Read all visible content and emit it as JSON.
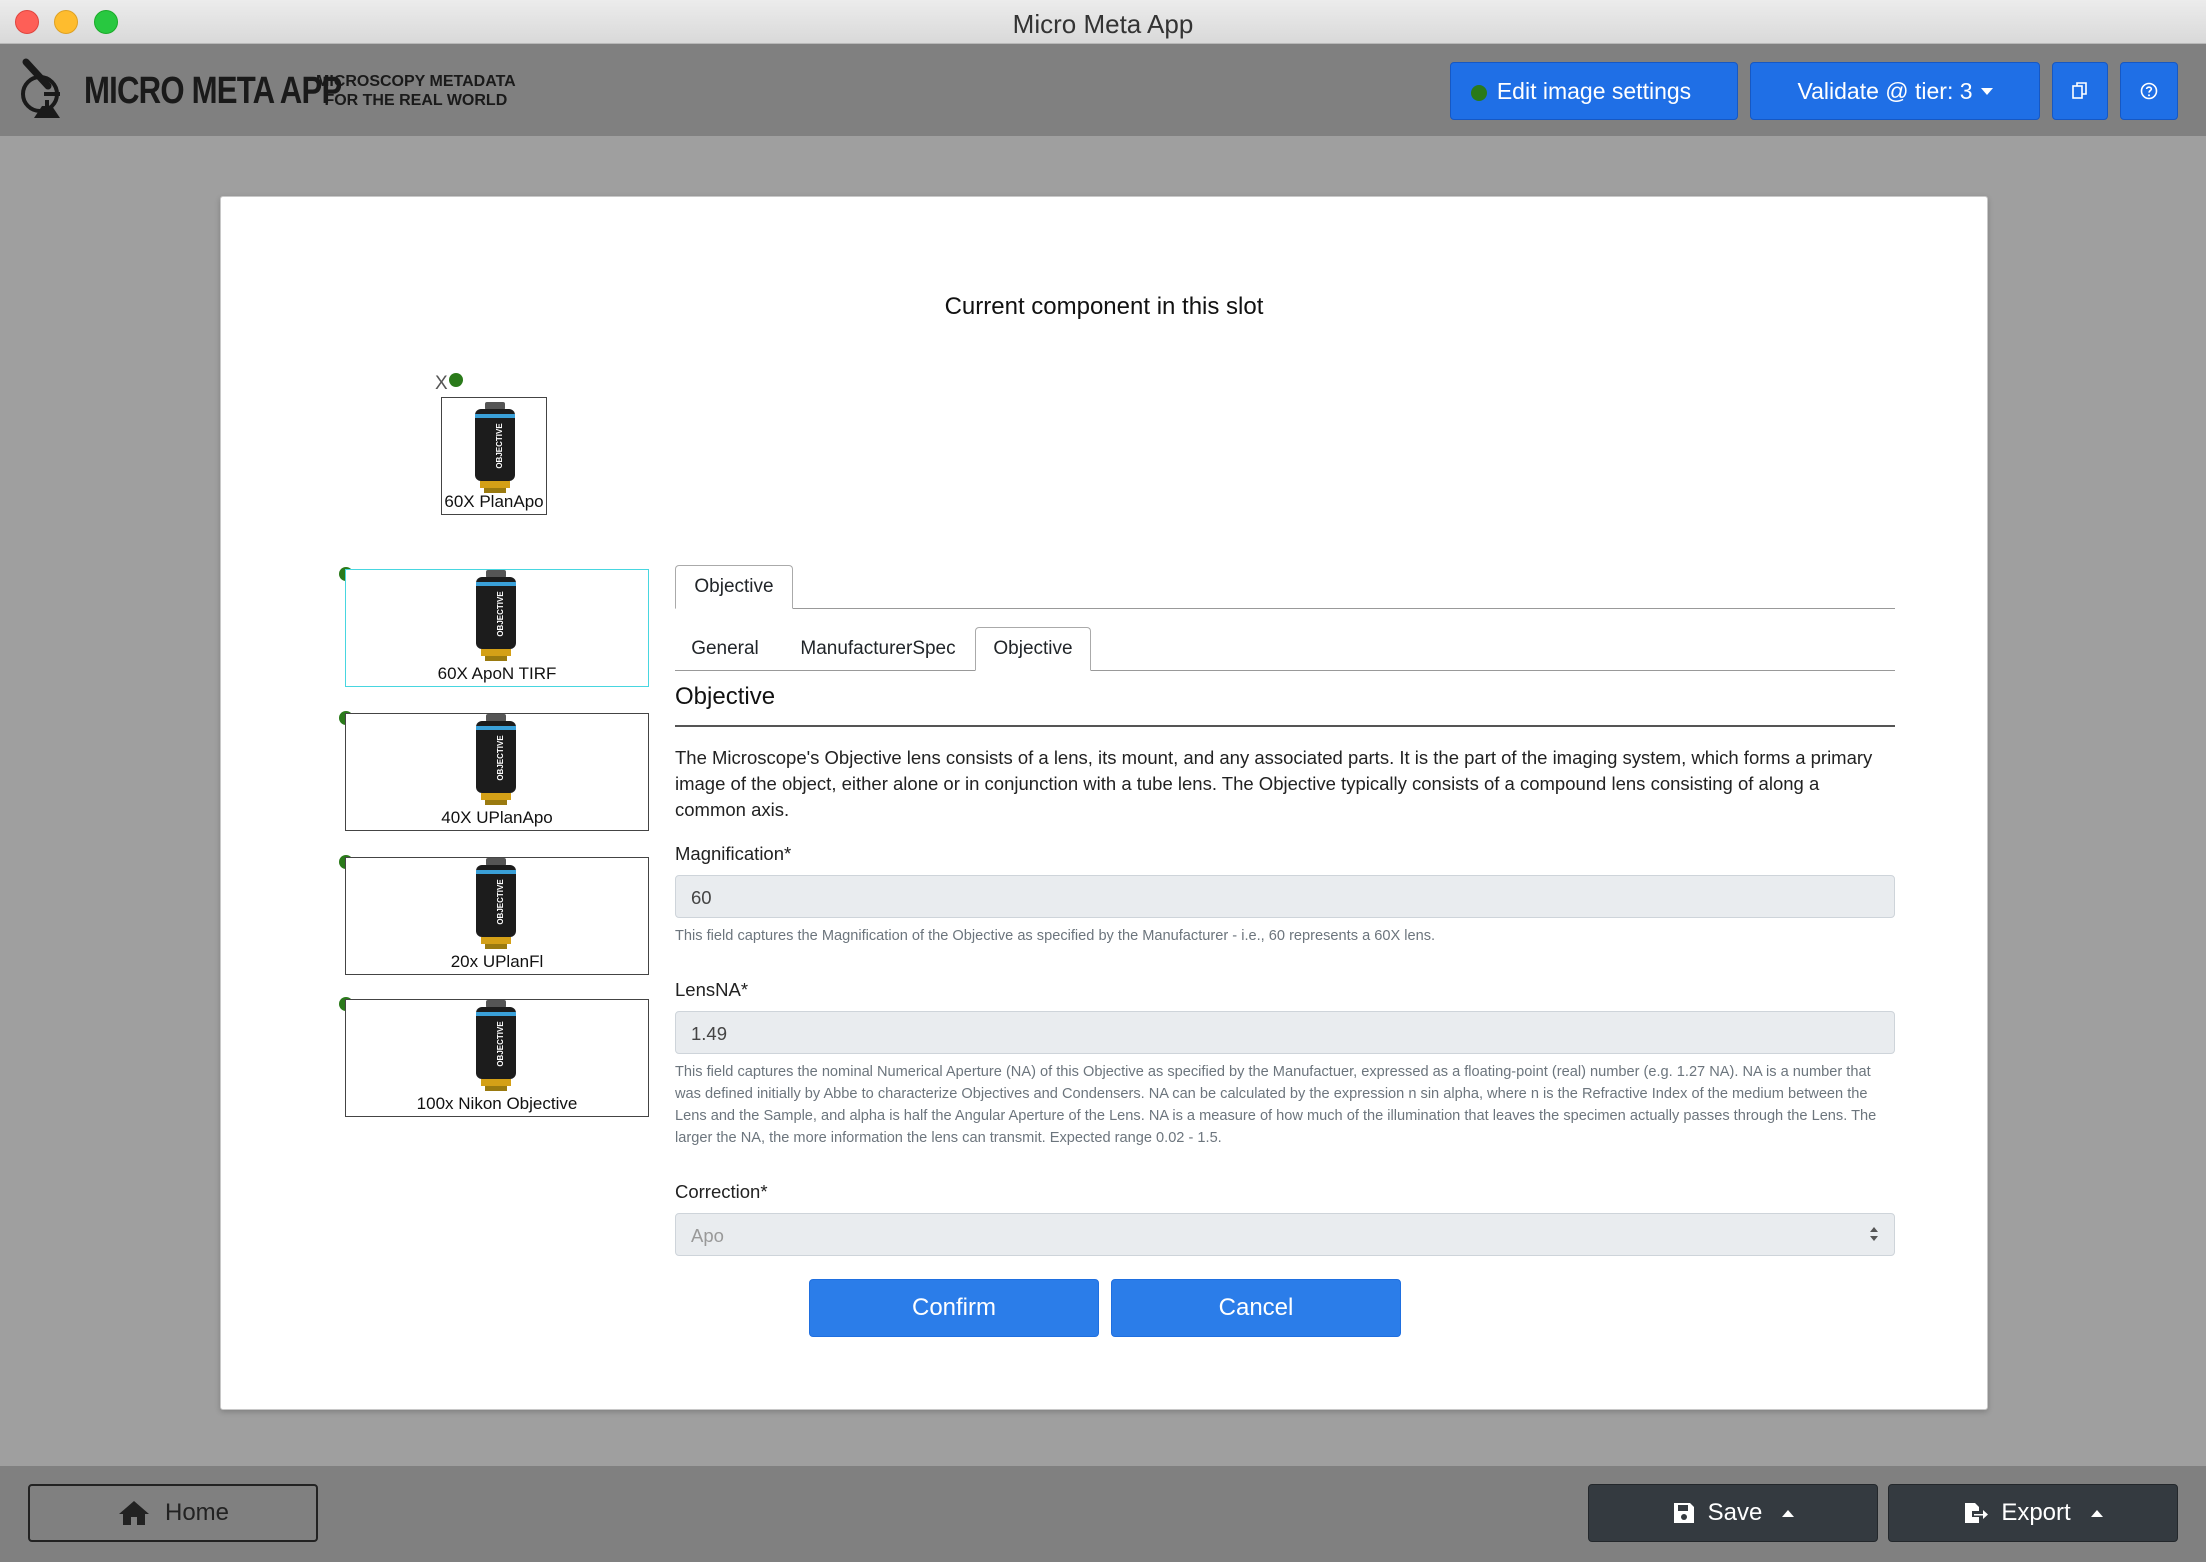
{
  "window": {
    "title": "Micro Meta App"
  },
  "header": {
    "logo_name": "MICRO META APP",
    "logo_tagline_line1": "MICROSCOPY METADATA",
    "logo_tagline_line2": "FOR THE REAL WORLD",
    "edit_label": "Edit image settings",
    "validate_label": "Validate @ tier: 3",
    "icon_copy": "copy-icon",
    "icon_help": "help-icon"
  },
  "dialog": {
    "title": "Current component in this slot",
    "current_slot": {
      "remove_label": "X",
      "label": "60X PlanApo"
    },
    "components": [
      {
        "label": "60X ApoN TIRF",
        "selected": true
      },
      {
        "label": "40X UPlanApo",
        "selected": false
      },
      {
        "label": "20x UPlanFl",
        "selected": false
      },
      {
        "label": "100x Nikon Objective",
        "selected": false
      }
    ],
    "top_tab": "Objective",
    "subtabs": [
      "General",
      "ManufacturerSpec",
      "Objective"
    ],
    "section_title": "Objective",
    "description": "The Microscope's Objective lens consists of a lens, its mount, and any associated parts. It is the part of the imaging system, which forms a primary image of the object, either alone or in conjunction with a tube lens. The Objective typically consists of a compound lens consisting of along a common axis.",
    "fields": {
      "magnification": {
        "label": "Magnification*",
        "value": "60",
        "help": "This field captures the Magnification of the Objective as specified by the Manufacturer - i.e., 60 represents a 60X lens."
      },
      "lens_na": {
        "label": "LensNA*",
        "value": "1.49",
        "help": "This field captures the nominal Numerical Aperture (NA) of this Objective as specified by the Manufactuer, expressed as a floating-point (real) number (e.g. 1.27 NA). NA is a number that was defined initially by Abbe to characterize Objectives and Condensers. NA can be calculated by the expression n sin alpha, where n is the Refractive Index of the medium between the Lens and the Sample, and alpha is half the Angular Aperture of the Lens. NA is a measure of how much of the illumination that leaves the specimen actually passes through the Lens. The larger the NA, the more information the lens can transmit. Expected range 0.02 - 1.5."
      },
      "correction": {
        "label": "Correction*",
        "value": "Apo"
      }
    },
    "confirm_label": "Confirm",
    "cancel_label": "Cancel"
  },
  "footer": {
    "home_label": "Home",
    "save_label": "Save",
    "export_label": "Export"
  },
  "colors": {
    "primary_blue": "#1f6fe6",
    "dark_button": "#343a40",
    "status_green": "#2a7a1a",
    "selected_border": "#48d6e0"
  }
}
